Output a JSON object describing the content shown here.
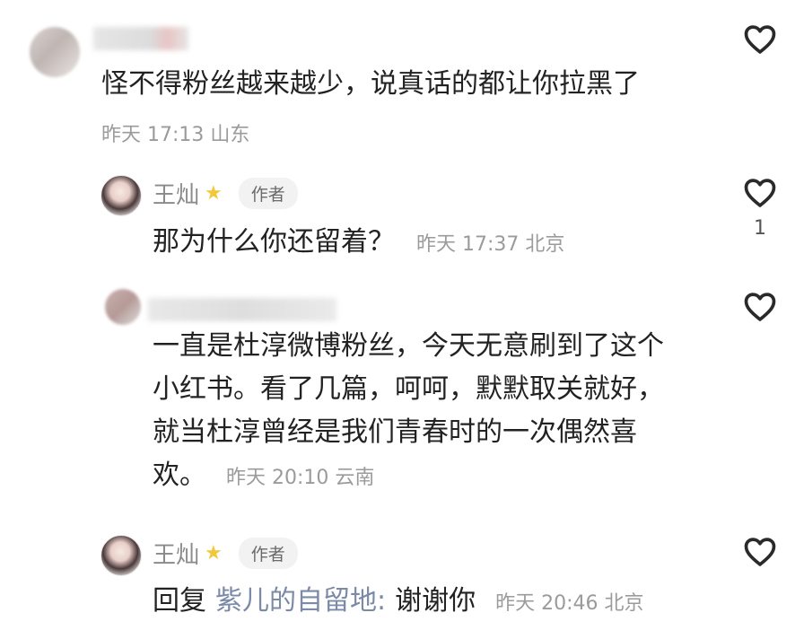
{
  "comments": [
    {
      "text": "怪不得粉丝越来越少，说真话的都让你拉黑了",
      "meta": "昨天 17:13 山东"
    },
    {
      "author_name": "王灿",
      "author_tag": "作者",
      "text": "那为什么你还留着？",
      "meta": "昨天 17:37 北京",
      "like_count": "1"
    },
    {
      "text_lines": [
        "一直是杜淳微博粉丝，今天无意刷到了这个",
        "小红书。看了几篇，呵呵，默默取关就好，",
        "就当杜淳曾经是我们青春时的一次偶然喜",
        "欢。"
      ],
      "meta": "昨天 20:10 云南"
    },
    {
      "author_name": "王灿",
      "author_tag": "作者",
      "reply_prefix": "回复",
      "reply_target": "紫儿的自留地:",
      "reply_text": "谢谢你",
      "meta": "昨天 20:46 北京"
    }
  ]
}
